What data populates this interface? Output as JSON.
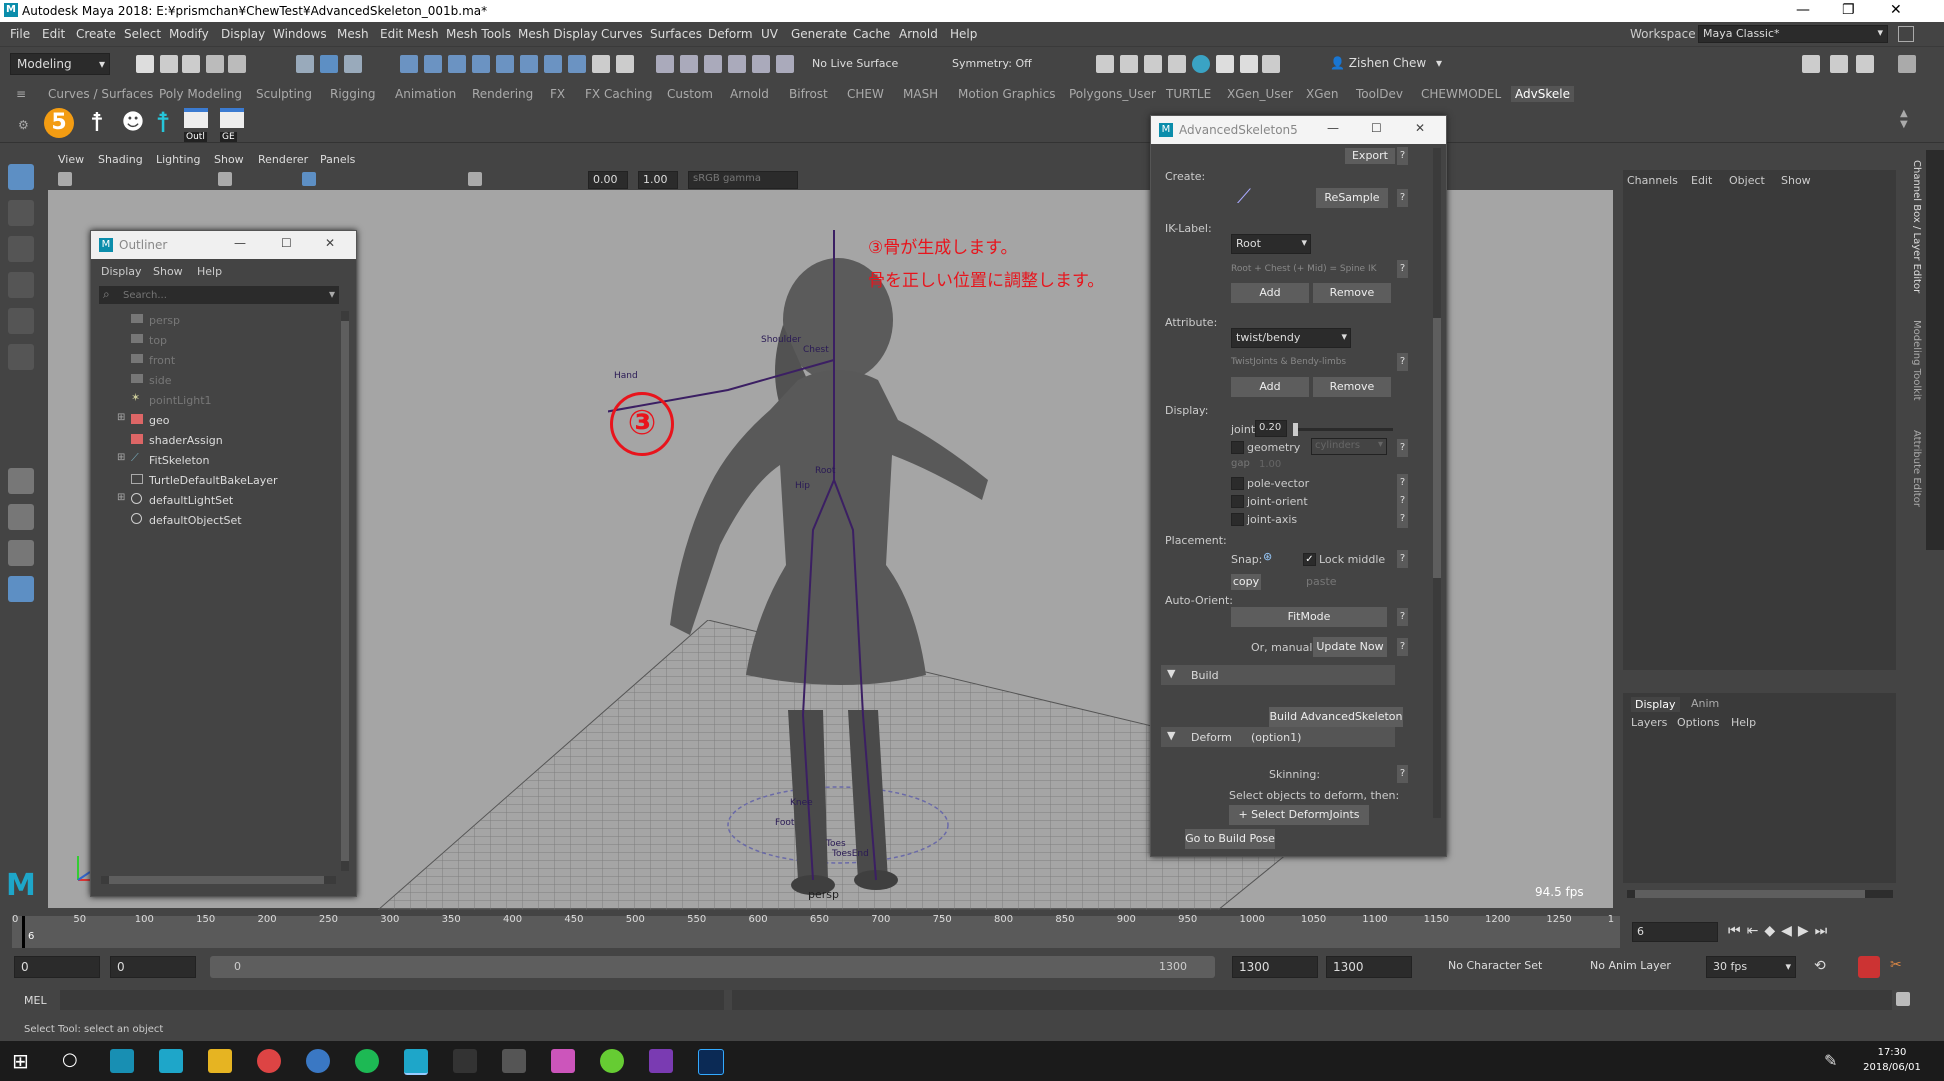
{
  "window": {
    "title": "Autodesk Maya 2018: E:¥prismchan¥ChewTest¥AdvancedSkeleton_001b.ma*"
  },
  "menus": [
    "File",
    "Edit",
    "Create",
    "Select",
    "Modify",
    "Display",
    "Windows",
    "Mesh",
    "Edit Mesh",
    "Mesh Tools",
    "Mesh Display",
    "Curves",
    "Surfaces",
    "Deform",
    "UV",
    "Generate",
    "Cache",
    "Arnold",
    "Help"
  ],
  "workspace": {
    "label": "Workspace :",
    "value": "Maya Classic*"
  },
  "status": {
    "mode": "Modeling",
    "live_surface": "No Live Surface",
    "symmetry": "Symmetry: Off",
    "user": "Zishen Chew"
  },
  "shelf_tabs": [
    "Curves / Surfaces",
    "Poly Modeling",
    "Sculpting",
    "Rigging",
    "Animation",
    "Rendering",
    "FX",
    "FX Caching",
    "Custom",
    "Arnold",
    "Bifrost",
    "CHEW",
    "MASH",
    "Motion Graphics",
    "Polygons_User",
    "TURTLE",
    "XGen_User",
    "XGen",
    "ToolDev",
    "CHEWMODEL",
    "AdvSkele"
  ],
  "shelf_icons": {
    "five": "5",
    "outl": "Outl",
    "ge": "GE"
  },
  "viewport": {
    "menus": [
      "View",
      "Shading",
      "Lighting",
      "Show",
      "Renderer",
      "Panels"
    ],
    "val1": "0.00",
    "val2": "1.00",
    "gamma": "sRGB gamma",
    "camera": "persp",
    "fps": "94.5 fps",
    "annotation_line1": "③骨が生成します。",
    "annotation_line2": "骨を正しい位置に調整します。",
    "step": "③",
    "joints": [
      "Shoulder",
      "Chest",
      "Hand",
      "Root",
      "Hip",
      "Knee",
      "Foot",
      "Toes",
      "ToesEnd"
    ]
  },
  "outliner": {
    "title": "Outliner",
    "menus": [
      "Display",
      "Show",
      "Help"
    ],
    "search_placeholder": "Search...",
    "items": [
      {
        "label": "persp",
        "dim": true
      },
      {
        "label": "top",
        "dim": true
      },
      {
        "label": "front",
        "dim": true
      },
      {
        "label": "side",
        "dim": true
      },
      {
        "label": "pointLight1",
        "dim": true
      },
      {
        "label": "geo",
        "dim": false
      },
      {
        "label": "shaderAssign",
        "dim": false
      },
      {
        "label": "FitSkeleton",
        "dim": false
      },
      {
        "label": "TurtleDefaultBakeLayer",
        "dim": false
      },
      {
        "label": "defaultLightSet",
        "dim": false
      },
      {
        "label": "defaultObjectSet",
        "dim": false
      }
    ]
  },
  "as_panel": {
    "title": "AdvancedSkeleton5",
    "export": "Export",
    "create": "Create:",
    "resample": "ReSample",
    "iklabel": "IK-Label:",
    "ik_value": "Root",
    "ik_hint": "Root + Chest (+ Mid) = Spine IK",
    "add": "Add",
    "remove": "Remove",
    "attribute": "Attribute:",
    "attr_value": "twist/bendy",
    "attr_hint": "TwistJoints & Bendy-limbs",
    "display": "Display:",
    "joint_label": "joint",
    "joint_value": "0.20",
    "geometry": "geometry",
    "cylinders": "cylinders",
    "gap": "gap",
    "gap_value": "1.00",
    "pole_vector": "pole-vector",
    "joint_orient": "joint-orient",
    "joint_axis": "joint-axis",
    "placement": "Placement:",
    "snap": "Snap:",
    "lock_middle": "Lock middle",
    "copy": "copy",
    "paste": "paste",
    "auto_orient": "Auto-Orient:",
    "fitmode": "FitMode",
    "or_manual": "Or, manual:",
    "update_now": "Update Now",
    "build": "Build",
    "build_btn": "Build AdvancedSkeleton",
    "deform": "Deform",
    "deform_opt": "(option1)",
    "skinning": "Skinning:",
    "select_hint": "Select objects to deform, then:",
    "select_btn": "+ Select DeformJoints",
    "goto": "Go to Build Pose"
  },
  "channelbox": {
    "menus": [
      "Channels",
      "Edit",
      "Object",
      "Show"
    ],
    "tabs": [
      "Display",
      "Anim"
    ],
    "layer_menus": [
      "Layers",
      "Options",
      "Help"
    ],
    "side_tabs": [
      "Channel Box / Layer Editor",
      "Modeling Toolkit",
      "Attribute Editor"
    ]
  },
  "timeline": {
    "ticks": [
      "0",
      "50",
      "100",
      "150",
      "200",
      "250",
      "300",
      "350",
      "400",
      "450",
      "500",
      "550",
      "600",
      "650",
      "700",
      "750",
      "800",
      "850",
      "900",
      "950",
      "1000",
      "1050",
      "1100",
      "1150",
      "1200",
      "1250",
      "1"
    ],
    "current": "6",
    "current_field": "6",
    "start": "0",
    "start2": "0",
    "range_start": "0",
    "range_end": "1300",
    "end1": "1300",
    "end2": "1300",
    "character_set": "No Character Set",
    "anim_layer": "No Anim Layer",
    "fps": "30 fps"
  },
  "command": {
    "label": "MEL",
    "help": "Select Tool: select an object"
  },
  "taskbar": {
    "time": "17:30",
    "date": "2018/06/01"
  }
}
